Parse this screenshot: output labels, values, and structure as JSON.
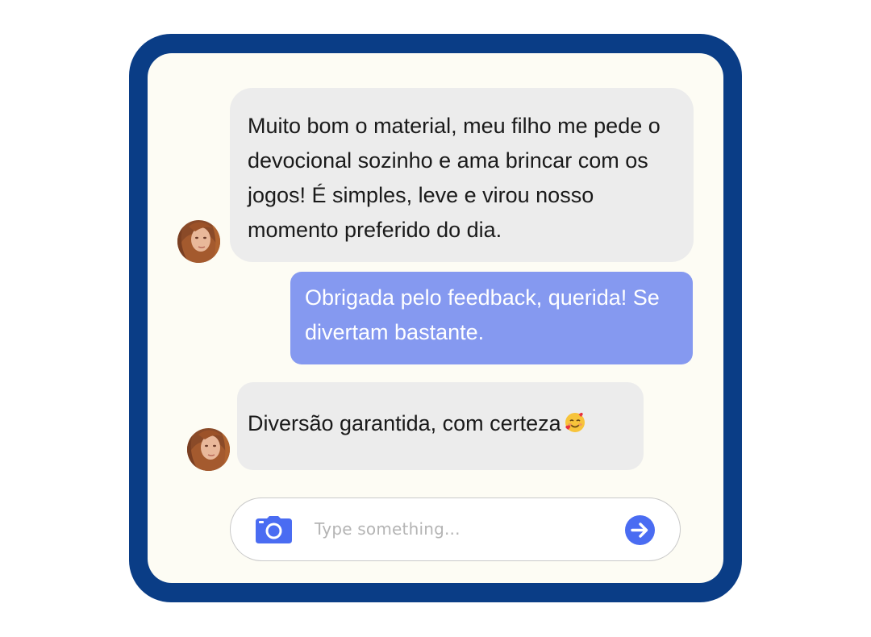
{
  "messages": [
    {
      "direction": "incoming",
      "text": "Muito bom o material, meu filho me pede o devocional sozinho e ama brincar com os jogos! É simples, leve e virou nosso momento preferido do dia."
    },
    {
      "direction": "outgoing",
      "text": "Obrigada pelo feedback, querida! Se divertam bastante."
    },
    {
      "direction": "incoming",
      "text": "Diversão garantida, com certeza",
      "emoji": "smiling-face-with-hearts-icon"
    }
  ],
  "composer": {
    "placeholder": "Type something...",
    "camera_icon": "camera-icon",
    "send_icon": "send-arrow-icon"
  },
  "colors": {
    "frame": "#0a3d86",
    "panel": "#fdfcf4",
    "incoming_bubble": "#ececec",
    "outgoing_bubble": "#8599f0",
    "accent": "#4a6cf2"
  }
}
